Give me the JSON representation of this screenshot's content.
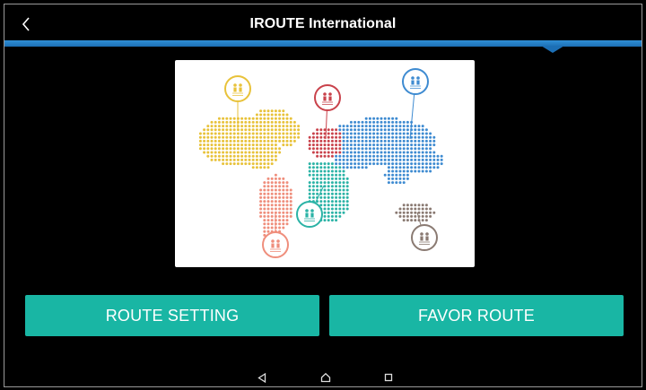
{
  "header": {
    "title": "IROUTE International",
    "back_icon": "chevron-left-icon"
  },
  "colors": {
    "accent_blue": "#1c6fb5",
    "button_teal": "#19b6a4",
    "map_yellow": "#e8c23a",
    "map_salmon": "#ef8e7c",
    "map_red": "#c9424b",
    "map_teal": "#2bb3a6",
    "map_blue": "#3e8bd1",
    "map_brown": "#8a7a72"
  },
  "illustration": {
    "subject": "world-map-icon",
    "pins": [
      "person-pin-icon",
      "person-pin-icon",
      "person-pin-icon",
      "person-pin-icon",
      "person-pin-icon",
      "person-pin-icon"
    ]
  },
  "buttons": {
    "route_setting": "ROUTE SETTING",
    "favor_route": "FAVOR ROUTE"
  },
  "navbar": {
    "back": "triangle-back-icon",
    "home": "home-icon",
    "recents": "square-recents-icon"
  }
}
